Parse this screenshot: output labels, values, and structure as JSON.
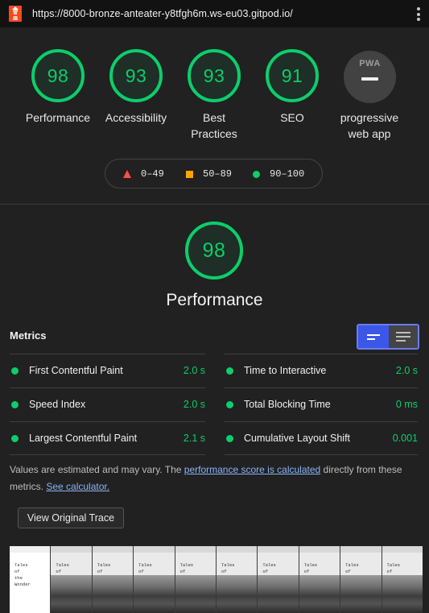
{
  "browser": {
    "url": "https://8000-bronze-anteater-y8tfgh6m.ws-eu03.gitpod.io/",
    "logo_icon": "lighthouse-icon",
    "menu_icon": "kebab-menu-icon"
  },
  "categories": [
    {
      "score": "98",
      "label": "Performance"
    },
    {
      "score": "93",
      "label": "Accessibility"
    },
    {
      "score": "93",
      "label_line1": "Best",
      "label_line2": "Practices"
    },
    {
      "score": "91",
      "label": "SEO"
    },
    {
      "badge": "PWA",
      "label_line1": "progressive",
      "label_line2": "web app"
    }
  ],
  "legend": [
    {
      "icon": "fail-triangle-icon",
      "range": "0–49",
      "color": "#ff4e42"
    },
    {
      "icon": "average-square-icon",
      "range": "50–89",
      "color": "#ffa400"
    },
    {
      "icon": "pass-circle-icon",
      "range": "90–100",
      "color": "#0cce6b"
    }
  ],
  "performance": {
    "score": "98",
    "title": "Performance"
  },
  "metrics": {
    "title": "Metrics",
    "left": [
      {
        "name": "First Contentful Paint",
        "value": "2.0 s"
      },
      {
        "name": "Speed Index",
        "value": "2.0 s"
      },
      {
        "name": "Largest Contentful Paint",
        "value": "2.1 s"
      }
    ],
    "right": [
      {
        "name": "Time to Interactive",
        "value": "2.0 s"
      },
      {
        "name": "Total Blocking Time",
        "value": "0 ms"
      },
      {
        "name": "Cumulative Layout Shift",
        "value": "0.001"
      }
    ]
  },
  "note": {
    "text1": "Values are estimated and may vary. The ",
    "link1": "performance score is calculated",
    "text2": " directly from these metrics. ",
    "link2": "See calculator."
  },
  "trace_button": "View Original Trace",
  "filmstrip": {
    "frame_text": [
      "Tales",
      "of",
      "the",
      "Wonder"
    ]
  },
  "colors": {
    "pass": "#0cce6b",
    "accent": "#3b57e8",
    "background": "#212121"
  }
}
